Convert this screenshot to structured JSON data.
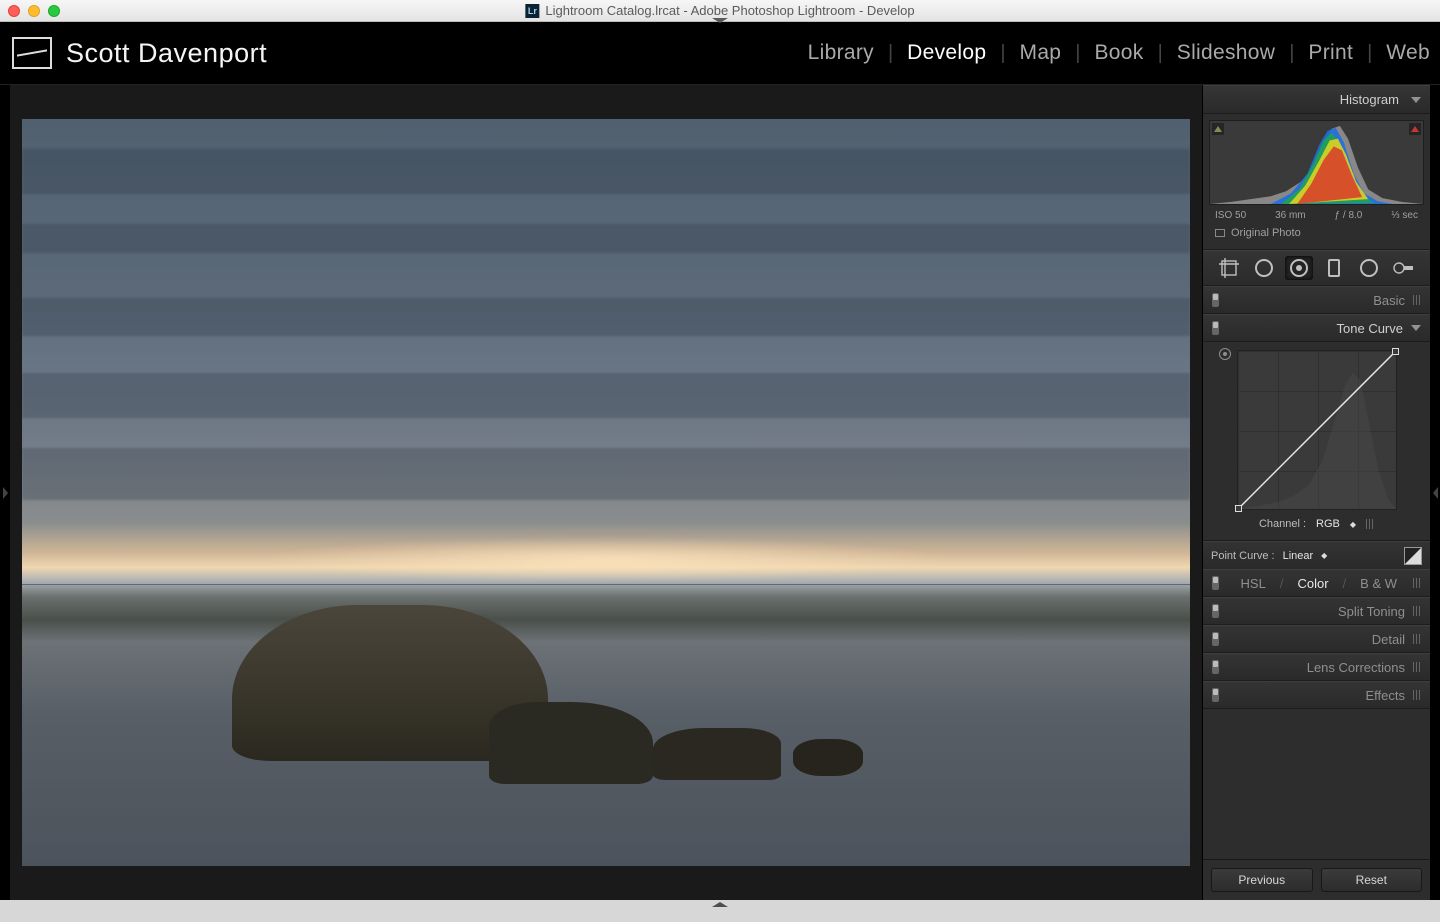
{
  "window": {
    "title": "Lightroom Catalog.lrcat - Adobe Photoshop Lightroom - Develop"
  },
  "identity": {
    "name": "Scott Davenport"
  },
  "modules": {
    "items": [
      "Library",
      "Develop",
      "Map",
      "Book",
      "Slideshow",
      "Print",
      "Web"
    ],
    "active": "Develop"
  },
  "histogram": {
    "title": "Histogram",
    "exif": {
      "iso": "ISO 50",
      "focal": "36 mm",
      "aperture": "ƒ / 8.0",
      "shutter": "⅓ sec"
    },
    "original_label": "Original Photo"
  },
  "tools": {
    "crop": "crop-tool",
    "spot": "spot-removal-tool",
    "redeye": "redeye-tool",
    "gradient": "graduated-filter-tool",
    "radial": "radial-filter-tool",
    "brush": "adjustment-brush-tool"
  },
  "panels": {
    "basic": "Basic",
    "tone_curve": "Tone Curve",
    "hsl": {
      "hsl": "HSL",
      "color": "Color",
      "bw": "B & W"
    },
    "split": "Split Toning",
    "detail": "Detail",
    "lens": "Lens Corrections",
    "effects": "Effects"
  },
  "tone_curve": {
    "channel_label": "Channel :",
    "channel_value": "RGB",
    "point_curve_label": "Point Curve :",
    "point_curve_value": "Linear"
  },
  "footer": {
    "previous": "Previous",
    "reset": "Reset"
  }
}
